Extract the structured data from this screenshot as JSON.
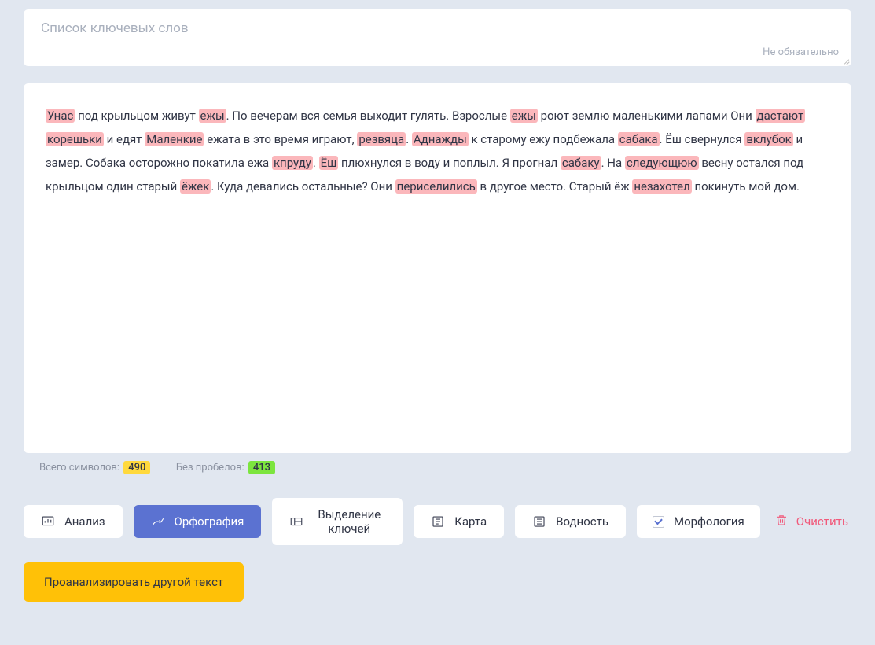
{
  "keywordInput": {
    "placeholder": "Список ключевых слов",
    "optionalHint": "Не обязательно"
  },
  "text": {
    "parts": [
      {
        "t": "hl",
        "v": "Унас"
      },
      {
        "t": "txt",
        "v": " под крыльцом живут "
      },
      {
        "t": "hl",
        "v": "ежы"
      },
      {
        "t": "txt",
        "v": ". По вечерам вся семья выходит гулять. Взрослые "
      },
      {
        "t": "hl",
        "v": "ежы"
      },
      {
        "t": "txt",
        "v": " роют землю маленькими лапами Они "
      },
      {
        "t": "hl",
        "v": "дастают"
      },
      {
        "t": "txt",
        "v": " "
      },
      {
        "t": "hl",
        "v": "корешьки"
      },
      {
        "t": "txt",
        "v": " и едят "
      },
      {
        "t": "hl",
        "v": "Маленкие"
      },
      {
        "t": "txt",
        "v": " ежата в это время играют, "
      },
      {
        "t": "hl",
        "v": "резвяца"
      },
      {
        "t": "txt",
        "v": ". "
      },
      {
        "t": "hl",
        "v": "Аднажды"
      },
      {
        "t": "txt",
        "v": " к старому ежу подбежала "
      },
      {
        "t": "hl",
        "v": "сабака"
      },
      {
        "t": "txt",
        "v": ". Ёш свернулся "
      },
      {
        "t": "hl",
        "v": "вклубок"
      },
      {
        "t": "txt",
        "v": " и замер. Собака осторожно покатила ежа "
      },
      {
        "t": "hl",
        "v": "кпруду"
      },
      {
        "t": "txt",
        "v": ". "
      },
      {
        "t": "hl",
        "v": "Ёш"
      },
      {
        "t": "txt",
        "v": " плюхнулся в воду и поплыл. Я прогнал "
      },
      {
        "t": "hl",
        "v": "сабаку"
      },
      {
        "t": "txt",
        "v": ". На "
      },
      {
        "t": "hl",
        "v": "следующюю"
      },
      {
        "t": "txt",
        "v": " весну остался под крыльцом один старый "
      },
      {
        "t": "hl",
        "v": "ёжек"
      },
      {
        "t": "txt",
        "v": ". Куда девались остальные? Они "
      },
      {
        "t": "hl",
        "v": "периселились"
      },
      {
        "t": "txt",
        "v": " в другое место. Старый ёж "
      },
      {
        "t": "hl",
        "v": "незахотел"
      },
      {
        "t": "txt",
        "v": " покинуть мой дом."
      }
    ]
  },
  "stats": {
    "totalLabel": "Всего символов:",
    "totalValue": "490",
    "noSpacesLabel": "Без пробелов:",
    "noSpacesValue": "413"
  },
  "toolbar": {
    "analysis": "Анализ",
    "spelling": "Орфография",
    "highlightKeys": "Выделение ключей",
    "map": "Карта",
    "water": "Водность",
    "morphology": "Морфология",
    "morphologyChecked": true,
    "clear": "Очистить"
  },
  "analyzeButton": "Проанализировать другой текст"
}
